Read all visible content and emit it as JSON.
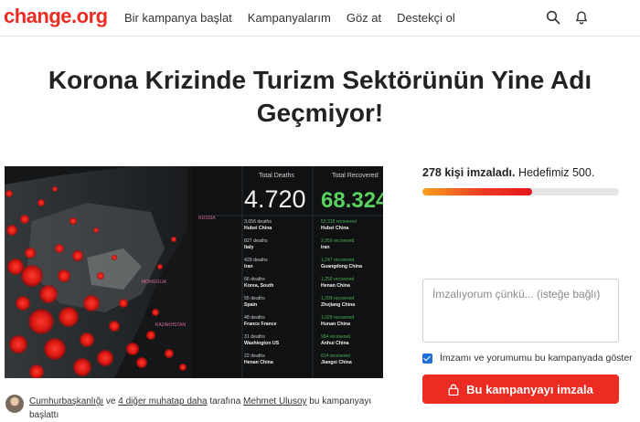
{
  "header": {
    "logo": "change.org",
    "nav": [
      "Bir kampanya başlat",
      "Kampanyalarım",
      "Göz at",
      "Destekçi ol"
    ],
    "icons": [
      "search-icon",
      "bell-icon"
    ]
  },
  "petition": {
    "title": "Korona Krizinde Turizm Sektörünün Yine Adı Geçmiyor!"
  },
  "hero": {
    "total_deaths_label": "Total Deaths",
    "total_deaths_value": "4.720",
    "total_recovered_label": "Total Recovered",
    "total_recovered_value": "68.324",
    "death_rows": [
      {
        "count": "3,056 deaths",
        "place": "Hubei China"
      },
      {
        "count": "827 deaths",
        "place": "Italy"
      },
      {
        "count": "429 deaths",
        "place": "Iran"
      },
      {
        "count": "66 deaths",
        "place": "Korea, South"
      },
      {
        "count": "55 deaths",
        "place": "Spain"
      },
      {
        "count": "48 deaths",
        "place": "France France"
      },
      {
        "count": "31 deaths",
        "place": "Washington US"
      },
      {
        "count": "22 deaths",
        "place": "Henan China"
      }
    ],
    "recovered_rows": [
      {
        "count": "50,318 recovered",
        "place": "Hubei China"
      },
      {
        "count": "2,959 recovered",
        "place": "Iran"
      },
      {
        "count": "1,247 recovered",
        "place": "Guangdong China"
      },
      {
        "count": "1,250 recovered",
        "place": "Henan China"
      },
      {
        "count": "1,209 recovered",
        "place": "Zhejiang China"
      },
      {
        "count": "1,029 recovered",
        "place": "Hunan China"
      },
      {
        "count": "954 recovered",
        "place": "Anhui China"
      },
      {
        "count": "814 recovered",
        "place": "Jiangxi China"
      }
    ],
    "map_labels": [
      "RUSSIA",
      "MONGOLIA",
      "KAZAKHSTAN"
    ]
  },
  "signatures": {
    "count_text": "278 kişi imzaladı.",
    "goal_text": "Hedefimiz 500.",
    "progress_fraction": 0.556
  },
  "form": {
    "reason_placeholder": "İmzalıyorum çünkü... (isteğe bağlı)",
    "display_checkbox_label": "İmzamı ve yorumumu bu kampanyada göster",
    "display_checked": true,
    "sign_button_label": "Bu kampanyayı imzala"
  },
  "starter": {
    "targets_link": "Cumhurbaşkanlığı",
    "and_text": " ve ",
    "others_link": "4 diğer muhatap daha",
    "by_text": " tarafına ",
    "author_link": "Mehmet Ulusoy",
    "started_text": " bu kampanyayı başlattı"
  },
  "colors": {
    "brand": "#ec2c22",
    "progress_start": "#f7a01c",
    "checkbox": "#1f6fd8",
    "recovered_green": "#4caf50"
  }
}
